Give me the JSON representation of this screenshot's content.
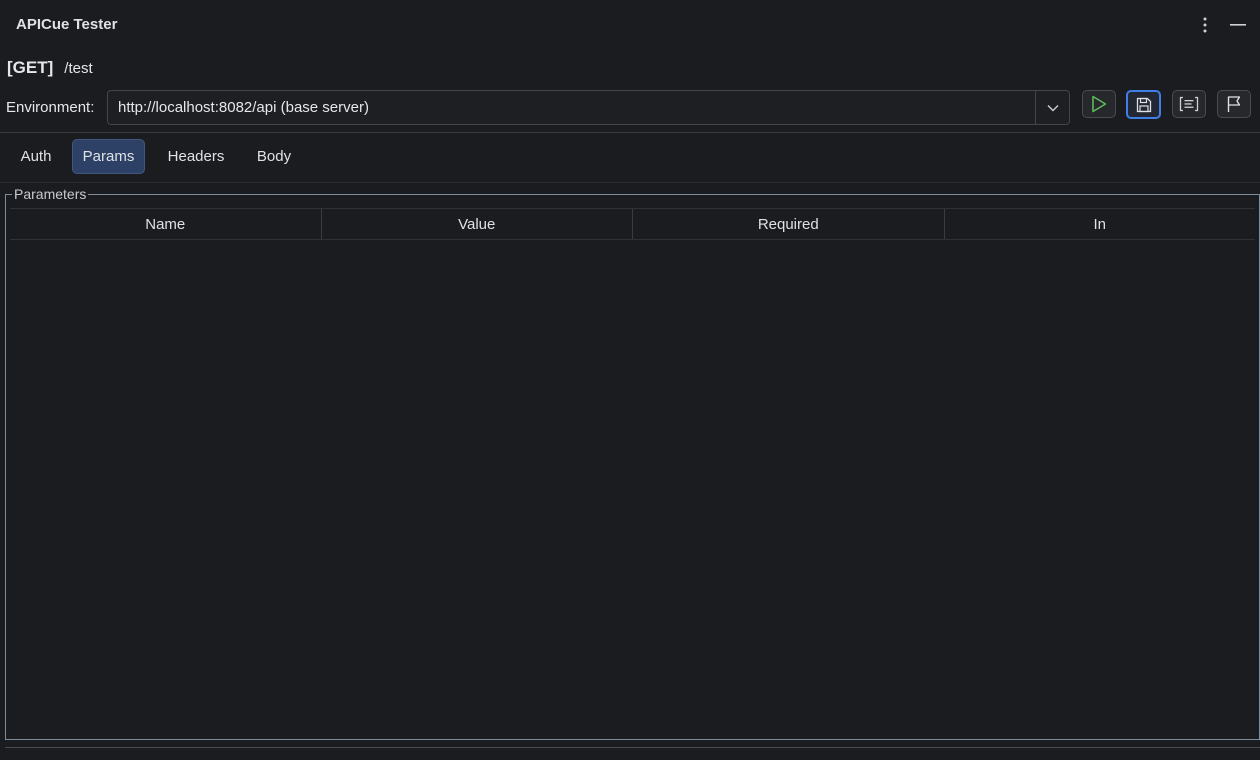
{
  "window": {
    "title": "APICue Tester",
    "more_icon": "vertical-ellipsis-icon",
    "minimize_icon": "minimize-icon"
  },
  "endpoint": {
    "method": "[GET]",
    "path": "/test"
  },
  "environment": {
    "label": "Environment:",
    "selected": "http://localhost:8082/api (base server)"
  },
  "toolbar": {
    "run_icon": "play-icon",
    "save_icon": "floppy-save-icon",
    "format_icon": "code-format-icon",
    "flag_icon": "flag-icon"
  },
  "tabs": [
    {
      "label": "Auth",
      "selected": false
    },
    {
      "label": "Params",
      "selected": true
    },
    {
      "label": "Headers",
      "selected": false
    },
    {
      "label": "Body",
      "selected": false
    }
  ],
  "parameters": {
    "legend": "Parameters",
    "columns": [
      "Name",
      "Value",
      "Required",
      "In"
    ],
    "rows": []
  },
  "colors": {
    "background": "#1b1c1f",
    "accent": "#3f7fe7",
    "selected_tab": "#2d4066",
    "run_green": "#5fb85a"
  }
}
